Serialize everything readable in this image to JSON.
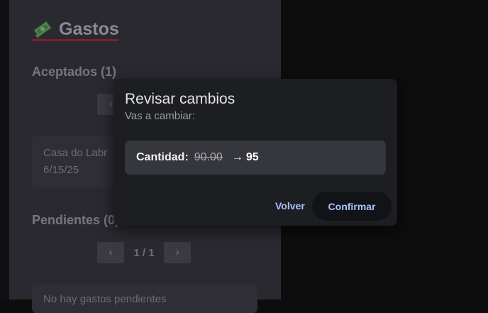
{
  "background": {
    "section_title": "Gastos",
    "accepted_heading": "Aceptados (1)",
    "accepted_pager": {
      "label": "",
      "prev_icon": "chevron-left-icon"
    },
    "accepted_item": {
      "name": "Casa do Labr",
      "date": "6/15/25"
    },
    "pending_heading": "Pendientes (0)",
    "pending_pager": {
      "label": "1 / 1",
      "prev": "‹",
      "next": "›"
    },
    "pending_empty": "No hay gastos pendientes"
  },
  "dialog": {
    "title": "Revisar cambios",
    "subtitle": "Vas a cambiar:",
    "change": {
      "field": "Cantidad:",
      "old_value": "90.00",
      "arrow": "→",
      "new_value": "95"
    },
    "back_label": "Volver",
    "confirm_label": "Confirmar"
  },
  "colors": {
    "accent": "#a9c3ff",
    "underline": "#7a2233",
    "dialog_bg": "#1d1e22"
  }
}
